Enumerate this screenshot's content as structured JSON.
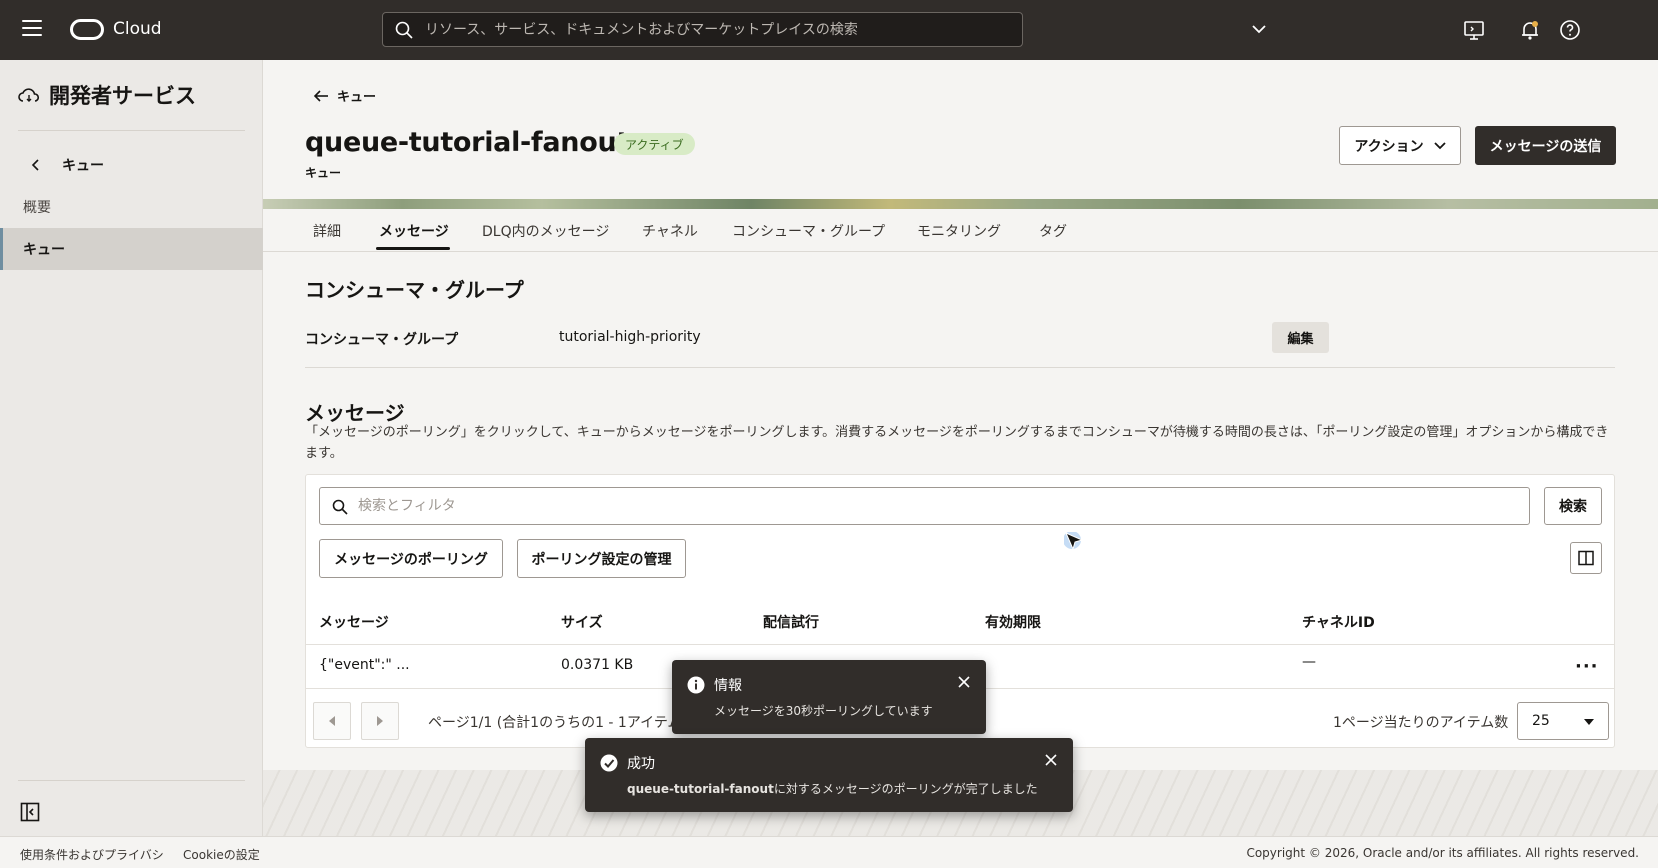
{
  "topbar": {
    "brand": "Cloud",
    "search_placeholder": "リソース、サービス、ドキュメントおよびマーケットプレイスの検索"
  },
  "sidebar": {
    "title": "開発者サービス",
    "back_label": "キュー",
    "items": [
      {
        "label": "概要",
        "active": false
      },
      {
        "label": "キュー",
        "active": true
      }
    ]
  },
  "header": {
    "breadcrumb": "キュー",
    "title": "queue-tutorial-fanout",
    "status": "アクティブ",
    "subtitle": "キュー",
    "actions_button": "アクション",
    "send_button": "メッセージの送信"
  },
  "tabs": [
    {
      "label": "詳細",
      "active": false
    },
    {
      "label": "メッセージ",
      "active": true
    },
    {
      "label": "DLQ内のメッセージ",
      "active": false
    },
    {
      "label": "チャネル",
      "active": false
    },
    {
      "label": "コンシューマ・グループ",
      "active": false
    },
    {
      "label": "モニタリング",
      "active": false
    },
    {
      "label": "タグ",
      "active": false
    }
  ],
  "consumer_group": {
    "section_title": "コンシューマ・グループ",
    "label": "コンシューマ・グループ",
    "value": "tutorial-high-priority",
    "edit_button": "編集"
  },
  "messages": {
    "section_title": "メッセージ",
    "description": "「メッセージのポーリング」をクリックして、キューからメッセージをポーリングします。消費するメッセージをポーリングするまでコンシューマが待機する時間の長さは、「ポーリング設定の管理」オプションから構成できます。",
    "filter_placeholder": "検索とフィルタ",
    "search_button": "検索",
    "poll_button": "メッセージのポーリング",
    "manage_button": "ポーリング設定の管理",
    "columns": [
      "メッセージ",
      "サイズ",
      "配信試行",
      "有効期限",
      "チャネルID"
    ],
    "rows": [
      {
        "message": "{\"event\":\" ...",
        "size": "0.0371 KB",
        "attempts": "",
        "expiry": "",
        "channel_id": "—"
      }
    ],
    "pager_text": "ページ1/1 (合計1のうちの1 - 1アイテム)",
    "per_page_label": "1ページ当たりのアイテム数",
    "per_page_value": "25"
  },
  "footer": {
    "terms": "使用条件およびプライバシ",
    "cookie": "Cookieの設定",
    "copyright": "Copyright © 2026, Oracle and/or its affiliates. All rights reserved."
  },
  "toasts": {
    "info": {
      "title": "情報",
      "message": "メッセージを30秒ポーリングしています"
    },
    "success": {
      "title": "成功",
      "message_bold": "queue-tutorial-fanout",
      "message_rest": "に対するメッセージのポーリングが完了しました"
    }
  },
  "colors": {
    "topbar": "#312d2a",
    "status_badge_bg": "#d8ebc6",
    "status_badge_text": "#3b6d20",
    "primary_button": "#312d2a"
  }
}
